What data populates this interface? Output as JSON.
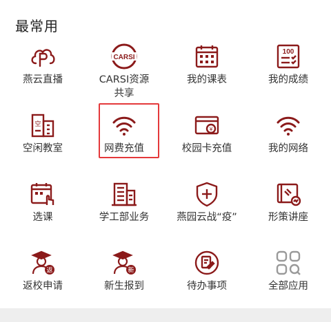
{
  "section": {
    "title": "最常用"
  },
  "colors": {
    "icon": "#8b1a1a",
    "icon_gray": "#999999",
    "highlight": "#e4383a"
  },
  "apps": [
    {
      "label": "燕云直播",
      "icon": "cloud-p-logo-icon"
    },
    {
      "label": "CARSI资源\n共享",
      "icon": "carsi-logo-icon"
    },
    {
      "label": "我的课表",
      "icon": "calendar-icon"
    },
    {
      "label": "我的成绩",
      "icon": "score-sheet-icon"
    },
    {
      "label": "空闲教室",
      "icon": "building-icon"
    },
    {
      "label": "网费充值",
      "icon": "wifi-icon"
    },
    {
      "label": "校园卡充值",
      "icon": "card-yen-icon"
    },
    {
      "label": "我的网络",
      "icon": "wifi-icon"
    },
    {
      "label": "选课",
      "icon": "calendar-hand-icon"
    },
    {
      "label": "学工部业务",
      "icon": "office-building-icon"
    },
    {
      "label": "燕园云战“疫”",
      "icon": "shield-plus-icon"
    },
    {
      "label": "形策讲座",
      "icon": "presentation-icon"
    },
    {
      "label": "返校申请",
      "icon": "graduate-return-icon"
    },
    {
      "label": "新生报到",
      "icon": "graduate-new-icon"
    },
    {
      "label": "待办事项",
      "icon": "todo-edit-icon"
    },
    {
      "label": "全部应用",
      "icon": "all-apps-icon"
    }
  ]
}
